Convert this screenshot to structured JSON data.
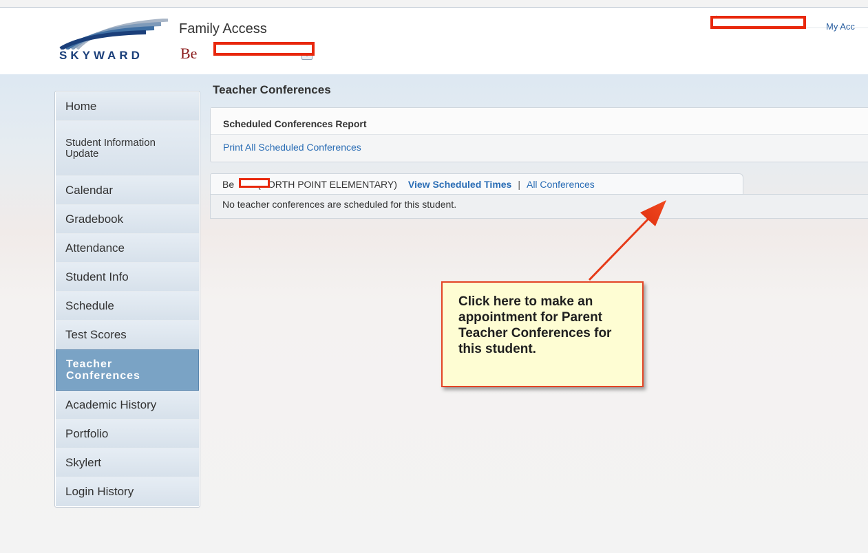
{
  "header": {
    "app_title": "Family Access",
    "logo_text": "SKYWARD",
    "student_prefix": "Be",
    "account_link": "My Acc"
  },
  "sidebar": {
    "items": [
      {
        "label": "Home"
      },
      {
        "label": "Student Information Update"
      },
      {
        "label": "Calendar"
      },
      {
        "label": "Gradebook"
      },
      {
        "label": "Attendance"
      },
      {
        "label": "Student Info"
      },
      {
        "label": "Schedule"
      },
      {
        "label": "Test Scores"
      },
      {
        "label": "Teacher Conferences",
        "active": true
      },
      {
        "label": "Academic History"
      },
      {
        "label": "Portfolio"
      },
      {
        "label": "Skylert"
      },
      {
        "label": "Login History"
      }
    ]
  },
  "main": {
    "page_title": "Teacher Conferences",
    "report": {
      "title": "Scheduled Conferences Report",
      "print_link": "Print All Scheduled Conferences"
    },
    "tab": {
      "student_name": "Be",
      "school": "(NORTH POINT ELEMENTARY)",
      "view_link": "View Scheduled Times",
      "separator": "|",
      "all_link": "All Conferences"
    },
    "empty_message": "No teacher conferences are scheduled for this student."
  },
  "callout": {
    "text": "Click here to make an appointment for Parent Teacher Conferences for this student."
  },
  "colors": {
    "brand_blue": "#1b3f7a",
    "link": "#2a6db5",
    "active_nav": "#7aa3c5",
    "annotation_red": "#e8280c",
    "callout_bg": "#fefdd3"
  }
}
